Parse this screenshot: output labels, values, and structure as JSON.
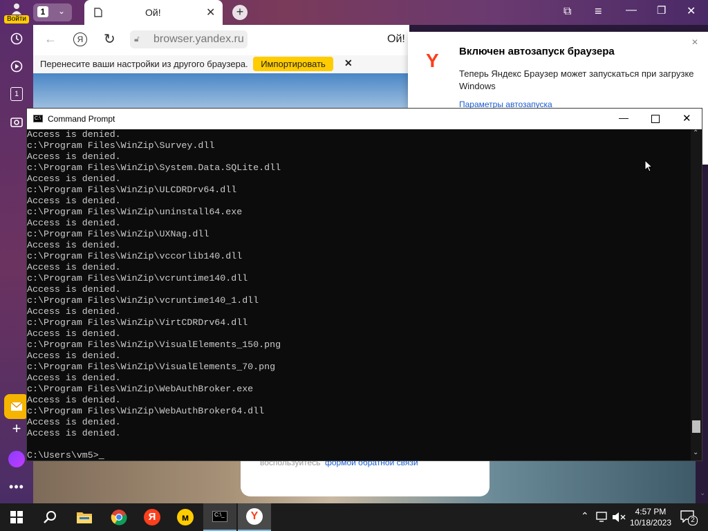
{
  "browser": {
    "profile_label": "Войти",
    "tab_counter": "1",
    "active_tab_title": "Ой!",
    "address": "browser.yandex.ru",
    "page_heading": "Ой!",
    "import_bar": {
      "text": "Перенесите ваши настройки из другого браузера.",
      "button_label": "Импортировать"
    },
    "notification": {
      "title": "Включен автозапуск браузера",
      "body": "Теперь Яндекс Браузер может запускаться при загрузке Windows",
      "link": "Параметры автозапуска"
    },
    "page_footer_text": "воспользуйтесь",
    "page_footer_link": "формой обратной связи",
    "rail_tab_counter": "1"
  },
  "cmd": {
    "title": "Command Prompt",
    "lines": [
      "Access is denied.",
      "c:\\Program Files\\WinZip\\Survey.dll",
      "Access is denied.",
      "c:\\Program Files\\WinZip\\System.Data.SQLite.dll",
      "Access is denied.",
      "c:\\Program Files\\WinZip\\ULCDRDrv64.dll",
      "Access is denied.",
      "c:\\Program Files\\WinZip\\uninstall64.exe",
      "Access is denied.",
      "c:\\Program Files\\WinZip\\UXNag.dll",
      "Access is denied.",
      "c:\\Program Files\\WinZip\\vccorlib140.dll",
      "Access is denied.",
      "c:\\Program Files\\WinZip\\vcruntime140.dll",
      "Access is denied.",
      "c:\\Program Files\\WinZip\\vcruntime140_1.dll",
      "Access is denied.",
      "c:\\Program Files\\WinZip\\VirtCDRDrv64.dll",
      "Access is denied.",
      "c:\\Program Files\\WinZip\\VisualElements_150.png",
      "Access is denied.",
      "c:\\Program Files\\WinZip\\VisualElements_70.png",
      "Access is denied.",
      "c:\\Program Files\\WinZip\\WebAuthBroker.exe",
      "Access is denied.",
      "c:\\Program Files\\WinZip\\WebAuthBroker64.dll",
      "Access is denied.",
      "Access is denied.",
      "",
      "C:\\Users\\vm5>"
    ]
  },
  "taskbar": {
    "time": "4:57 PM",
    "date": "10/18/2023",
    "notification_count": "2"
  },
  "colors": {
    "cmd_bg": "#0c0c0c",
    "cmd_text": "#cccccc",
    "taskbar_bg": "#1c1c1c",
    "yandex_red": "#fc3f1d",
    "import_button": "#ffcc00"
  }
}
